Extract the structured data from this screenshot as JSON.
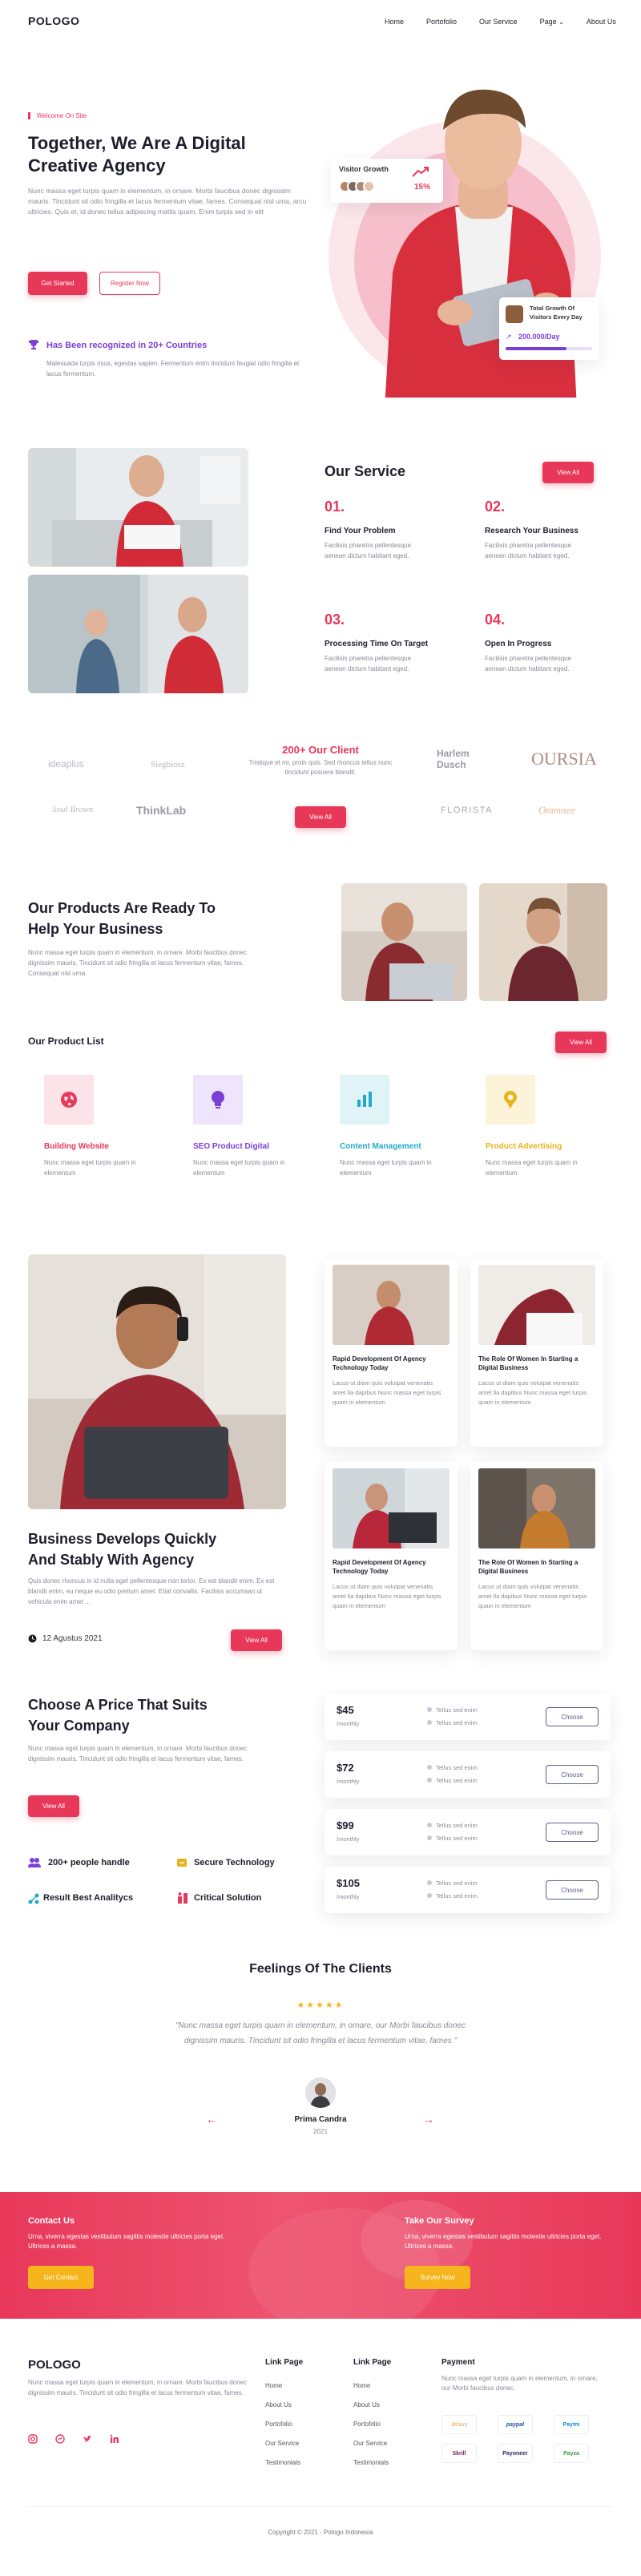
{
  "brand": "POLOGO",
  "nav": {
    "items": [
      "Home",
      "Portofolio",
      "Our Service",
      "Page",
      "About Us"
    ]
  },
  "hero": {
    "tag": "Welcome On Site",
    "title": "Together, We Are A Digital Creative Agency",
    "desc": "Nunc massa eget turpis quam in elementum, in ornare. Morbi faucibus donec dignissim mauris. Tincidunt sit odio fringilla et lacus fermentum vitae, fames. Consequat nisl urna, arcu ultricies. Quis et, id donec tellus adipiscing mattis quam. Enim turpis sed in elit",
    "btn_primary": "Get Started",
    "btn_secondary": "Register Now",
    "recognized": "Has Been recognized in 20+ Countries",
    "recognized_desc": "Malesuada turpis risus, egestas sapien. Fermentum enim tincidunt feugiat odio fringilla et lacus fermentum.",
    "visitor_label": "Visitor Growth",
    "visitor_pct": "15%",
    "total_label": "Total Growth Of Visitors Every Day",
    "total_value": "200.000/Day"
  },
  "service": {
    "title": "Our Service",
    "view_all": "View All",
    "items": [
      {
        "num": "01.",
        "title": "Find Your Problem",
        "desc": "Facilisis pharetra pellentesque aenean dictum habitant eged."
      },
      {
        "num": "02.",
        "title": "Research Your Business",
        "desc": "Facilisis pharetra pellentesque aenean dictum habitant eged."
      },
      {
        "num": "03.",
        "title": "Processing Time On Target",
        "desc": "Facilisis pharetra pellentesque aenean dictum habitant eged."
      },
      {
        "num": "04.",
        "title": "Open In Progress",
        "desc": "Facilisis pharetra pellentesque aenean dictum habitant eged."
      }
    ]
  },
  "clients": {
    "title": "200+ Our Client",
    "desc": "Tristique et mi, proin quis. Sed rhoncus tellus nunc tincidunt posuere blandit.",
    "view_all": "View All",
    "logos": [
      "ideaplus",
      "Siegbiosz",
      "Harlem Dusch",
      "OURSIA",
      "Soul Brown",
      "ThinkLab",
      "FLORISTA",
      "Ommnee"
    ]
  },
  "products": {
    "title": "Our Products Are Ready To Help Your Business",
    "desc": "Nunc massa eget turpis quam in elementum, in ornare. Morbi faucibus donec dignissim mauris. Tincidunt sit odio fringilla et lacus fermentum vitae, fames. Consequat nisl urna.",
    "list_title": "Our Product List",
    "view_all": "View All",
    "items": [
      {
        "title": "Building Website",
        "desc": "Nunc massa eget turpis quam in elementum",
        "color": "#e8385a"
      },
      {
        "title": "SEO Product Digital",
        "desc": "Nunc massa eget turpis quam in elementum",
        "color": "#7b3fd6"
      },
      {
        "title": "Content Management",
        "desc": "Nunc massa eget turpis quam in elementum",
        "color": "#22a9c8"
      },
      {
        "title": "Product Advertising",
        "desc": "Nunc massa eget turpis quam in elementum",
        "color": "#e8b21a"
      }
    ]
  },
  "blog": {
    "title": "Business Develops Quickly And Stably With Agency",
    "desc": "Quis donec rhoncus in id nulla eget pellentesque non tortor. Ex est blandit enim. Ex est blandit enim, eu neque eu odio pretium amet. Etiat convallis. Facilisis accumsan ut vehicula enim amet ...",
    "date": "12 Agustus 2021",
    "view_all": "View All",
    "cards": [
      {
        "title": "Rapid Development Of Agency Technology Today",
        "desc": "Lacus ut diam quis volutpat venenatis amet lla dapibus Nunc massa eget turpis quam in elementum"
      },
      {
        "title": "The Role Of Women In Starting a Digital Business",
        "desc": "Lacus ut diam quis volutpat venenatis amet lla dapibus Nunc massa eget turpis quam in elementum"
      },
      {
        "title": "Rapid Development Of Agency Technology Today",
        "desc": "Lacus ut diam quis volutpat venenatis amet lla dapibus Nunc massa eget turpis quam in elementum"
      },
      {
        "title": "The Role Of Women In Starting a Digital Business",
        "desc": "Lacus ut diam quis volutpat venenatis amet lla dapibus Nunc massa eget turpis quam in elementum"
      }
    ]
  },
  "pricing": {
    "title": "Choose A Price That Suits Your Company",
    "desc": "Nunc massa eget turpis quam in elementum, in ornare. Morbi faucibus donec dignissim mauris. Tincidunt sit odio fringilla et lacus fermentum vitae, fames.",
    "view_all": "View All",
    "features": [
      "200+ people handle",
      "Secure Technology",
      "Result Best Analitycs",
      "Critical Solution"
    ],
    "plans": [
      {
        "price": "$45",
        "period": "/monthly",
        "f1": "Tellus sed enim",
        "f2": "Tellus sed enim",
        "btn": "Choose"
      },
      {
        "price": "$72",
        "period": "/monthly",
        "f1": "Tellus sed enim",
        "f2": "Tellus sed enim",
        "btn": "Choose"
      },
      {
        "price": "$99",
        "period": "/monthly",
        "f1": "Tellus sed enim",
        "f2": "Tellus sed enim",
        "btn": "Choose"
      },
      {
        "price": "$105",
        "period": "/monthly",
        "f1": "Tellus sed enim",
        "f2": "Tellus sed enim",
        "btn": "Choose"
      }
    ]
  },
  "testimonial": {
    "title": "Feelings Of The Clients",
    "stars": "★★★★★",
    "quote": "\"Nunc massa eget turpis quam in elementum, in ornare, our Morbi faucibus donec dignissim mauris. Tincidunt sit odio fringilla et lacus fermentum vitae, fames \"",
    "name": "Prima Candra",
    "year": "2021"
  },
  "cta": {
    "contact_title": "Contact Us",
    "contact_desc": "Urna, viverra egestas vestibulum sagittis molestie ultricies porta eget. Ultrices a massa.",
    "contact_btn": "Get Contact",
    "survey_title": "Take Our Survey",
    "survey_desc": "Urna, viverra egestas vestibulum sagittis molestie ultricies porta eget. Ultrices a massa.",
    "survey_btn": "Survey Now"
  },
  "footer": {
    "brand": "POLOGO",
    "desc": "Nunc massa eget turpis quam in elementum, in ornare. Morbi faucibus donec dignissim mauris. Tincidunt sit odio fringilla et lacus fermentum vitae, fames.",
    "col1_title": "Link Page",
    "col1": [
      "Home",
      "About Us",
      "Portofolio",
      "Our Service",
      "Testimonials"
    ],
    "col2_title": "Link Page",
    "col2": [
      "Home",
      "About Us",
      "Portofolio",
      "Our Service",
      "Testimonials"
    ],
    "pay_title": "Payment",
    "pay_desc": "Nunc massa eget turpis quam in elementum, in ornare, our Morbi faucibus donec.",
    "payments": [
      "Jenius",
      "paypal",
      "Paytm",
      "Skrill",
      "Payoneer",
      "Payza"
    ],
    "copyright": "Copyright © 2021 - Pologo Indonesia"
  },
  "colors": {
    "accent": "#e8385a",
    "purple": "#7b3fd6",
    "dark": "#1e1e2c"
  }
}
